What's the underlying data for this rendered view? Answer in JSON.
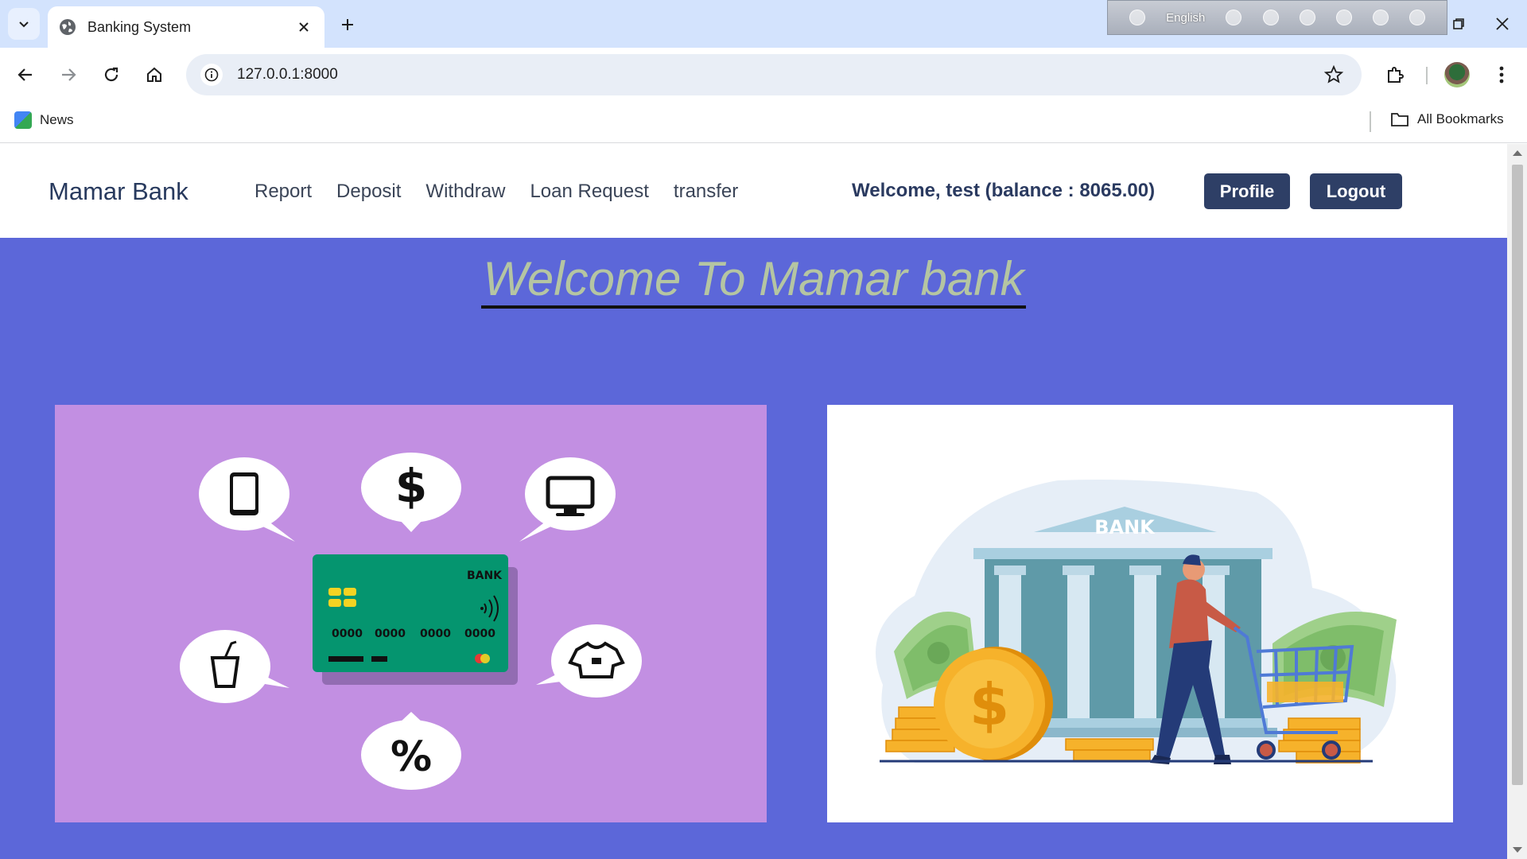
{
  "browser": {
    "tab_title": "Banking System",
    "url": "127.0.0.1:8000",
    "bookmarks": {
      "news": "News",
      "all": "All Bookmarks"
    },
    "ime_language": "English"
  },
  "site": {
    "brand": "Mamar Bank",
    "nav_links": [
      "Report",
      "Deposit",
      "Withdraw",
      "Loan Request",
      "transfer"
    ],
    "welcome": "Welcome, test (balance : 8065.00)",
    "profile_label": "Profile",
    "logout_label": "Logout",
    "hero_title": "Welcome To Mamar bank"
  },
  "card_illustration": {
    "bank_label": "BANK",
    "card_numbers": [
      "0000",
      "0000",
      "0000",
      "0000"
    ],
    "bubbles": {
      "dollar": "$",
      "percent": "%"
    },
    "colors": {
      "background": "#c28fe2",
      "card": "#05956f",
      "chip": "#f5d322"
    }
  },
  "bank_illustration": {
    "bank_sign": "BANK",
    "coin_symbol": "$",
    "colors": {
      "building": "#5f9aa8",
      "coin": "#f6b22b",
      "cash": "#9fd08a",
      "shirt": "#c85a46"
    }
  },
  "colors": {
    "page_background": "#5c67d9",
    "nav_text": "#283a5e",
    "button_dark": "#2e3f66",
    "hero_text": "#b5c5a2"
  }
}
